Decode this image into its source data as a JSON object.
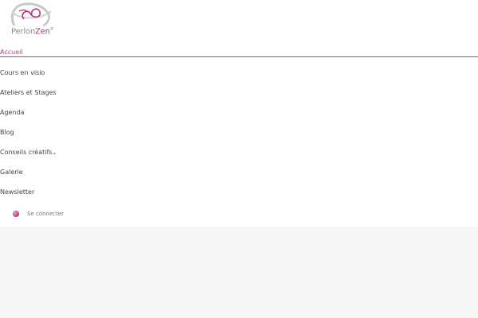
{
  "brand": {
    "name_part1": "Perlon",
    "name_part2": "Zen",
    "registered": "®"
  },
  "nav": {
    "items": [
      {
        "label": "Accueil",
        "active": true
      },
      {
        "label": "Cours en visio"
      },
      {
        "label": "Ateliers et Stages"
      },
      {
        "label": "Agenda"
      },
      {
        "label": "Blog"
      },
      {
        "label": "Conseils créatifs",
        "caret": "⌄"
      },
      {
        "label": "Galerie"
      },
      {
        "label": "Newsletter"
      }
    ]
  },
  "account": {
    "login_label": "Se connecter"
  },
  "colors": {
    "accent": "#c2397f",
    "background": "#f6f6f6",
    "header_bg": "#ffffff"
  }
}
